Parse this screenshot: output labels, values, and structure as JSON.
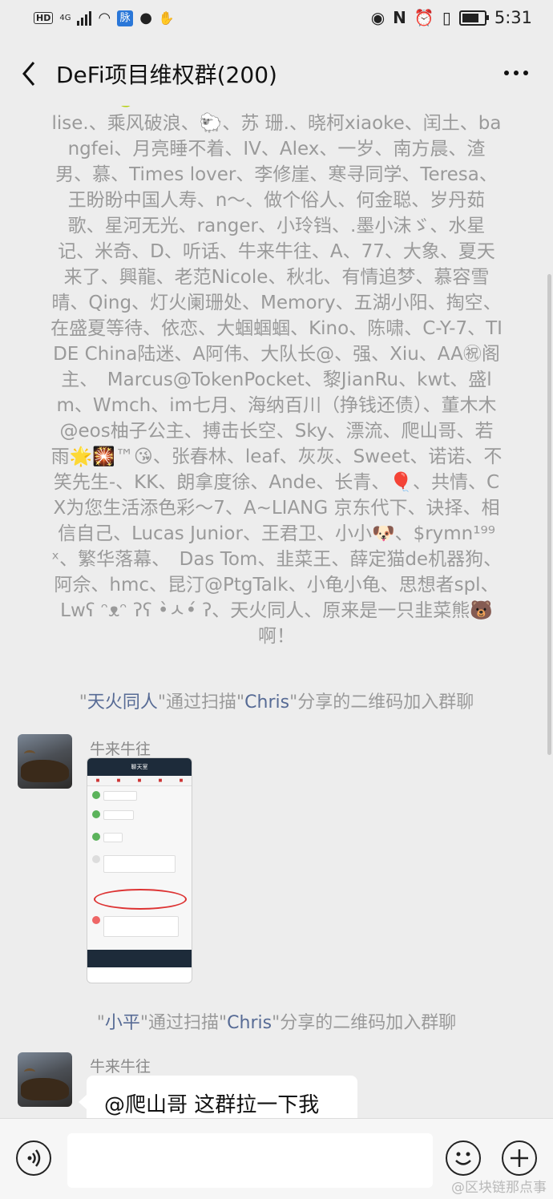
{
  "status_bar": {
    "hd": "HD",
    "network": "4G",
    "app_badge": "脉",
    "time": "5:31"
  },
  "header": {
    "title": "DeFi项目维权群(200)"
  },
  "member_list_text": "TD社区🍐、鼎胜国际、贾心人净、LL、王晴飞、恋、Elise.、乘风破浪、🐑、苏 珊.、晓柯xiaoke、闰土、bangfei、月亮睡不着、IV、Alex、一岁、南方晨、渣男、慕、Times lover、李修崖、寒寻同学、Teresa、王盼盼中国人寿、n～、做个俗人、何金聪、岁丹茹歌、星河无光、ranger、小玲铛、.墨小沫ゞ、水星记、米奇、D、听话、牛来牛往、A、77、大象、夏天来了、興龍、老范Nicole、秋北、有情追梦、慕容雪晴、Qing、灯火阑珊处、Memory、五湖小阳、掏空、在盛夏等待、依恋、大蝈蝈蝈、Kino、陈啸、C-Y-7、TIDE China陆迷、A阿伟、大队长@、强、Xiu、AA㊗阁主、　Marcus@TokenPocket、黎JianRu、kwt、盛lm、Wmch、im七月、海纳百川（挣钱还债）、董木木@eos柚子公主、搏击长空、Sky、漂流、爬山哥、若　　雨🌟🎇™😘、张春林、leaf、灰灰、Sweet、诺诺、不笑先生-、KK、朗拿度徐、Ande、长青、🎈、共情、CX为您生活添色彩～7、A~LIANG 京东代下、诀择、相信自己、Lucas Junior、王君卫、小小🐶、$rymn¹⁹⁹ˣ、繁华落幕、　Das Tom、韭菜王、薛定猫de机器狗、阿佘、hmc、昆汀@PtgTalk、小龟小龟、思想者spl、Lwʕ ᵔᴥᵔ ʔʕ •̀ㅅ•́ ʔ、天火同人、原来是一只韭菜熊🐻啊！",
  "join_notice_1": {
    "pre": "\"",
    "name": "天火同人",
    "post": "\"通过扫描\"",
    "via": "Chris",
    "tail": "\"分享的二维码加入群聊"
  },
  "message_1": {
    "sender": "牛来牛往",
    "image_caption": "聊天室"
  },
  "join_notice_2": {
    "pre": "\"",
    "name": "小平",
    "post": "\"通过扫描\"",
    "via": "Chris",
    "tail": "\"分享的二维码加入群聊"
  },
  "message_2": {
    "sender": "牛来牛往",
    "text": "@爬山哥 这群拉一下我"
  },
  "watermark": "@区块链那点事",
  "icons": [
    "back-icon",
    "more-icon",
    "voice-icon",
    "emoji-icon",
    "plus-icon"
  ],
  "colors": {
    "link_name": "#576b95",
    "background": "#ededed"
  }
}
